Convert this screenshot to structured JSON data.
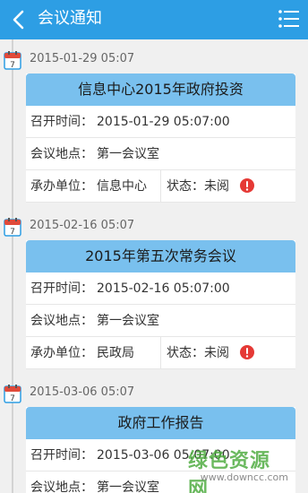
{
  "header": {
    "title": "会议通知",
    "back_icon": "back-arrow-icon",
    "menu_icon": "list-menu-icon",
    "background": "#2d9ee4"
  },
  "meetings": [
    {
      "date": "2015-01-29 05:07",
      "title": "信息中心2015年政府投资",
      "time_label": "召开时间：",
      "time_value": "2015-01-29 05:07:00",
      "place_label": "会议地点：",
      "place_value": "第一会议室",
      "unit_label": "承办单位：",
      "unit_value": "信息中心",
      "status_label": "状态：",
      "status_value": "未阅"
    },
    {
      "date": "2015-02-16 05:07",
      "title": "2015年第五次常务会议",
      "time_label": "召开时间：",
      "time_value": "2015-02-16 05:07:00",
      "place_label": "会议地点：",
      "place_value": "第一会议室",
      "unit_label": "承办单位：",
      "unit_value": "民政局",
      "status_label": "状态：",
      "status_value": "未阅"
    },
    {
      "date": "2015-03-06 05:07",
      "title": "政府工作报告",
      "time_label": "召开时间：",
      "time_value": "2015-03-06 05:07:00",
      "place_label": "会议地点：",
      "place_value": "第一会议室"
    }
  ],
  "icons": {
    "calendar": "calendar-icon",
    "alert": "alert-icon"
  },
  "colors": {
    "card_title_bg": "#79c0ee",
    "alert": "#e53935",
    "calendar": "#2d9ee4"
  },
  "watermark": {
    "text": "绿色资源网",
    "url": "www.downcc.com"
  }
}
